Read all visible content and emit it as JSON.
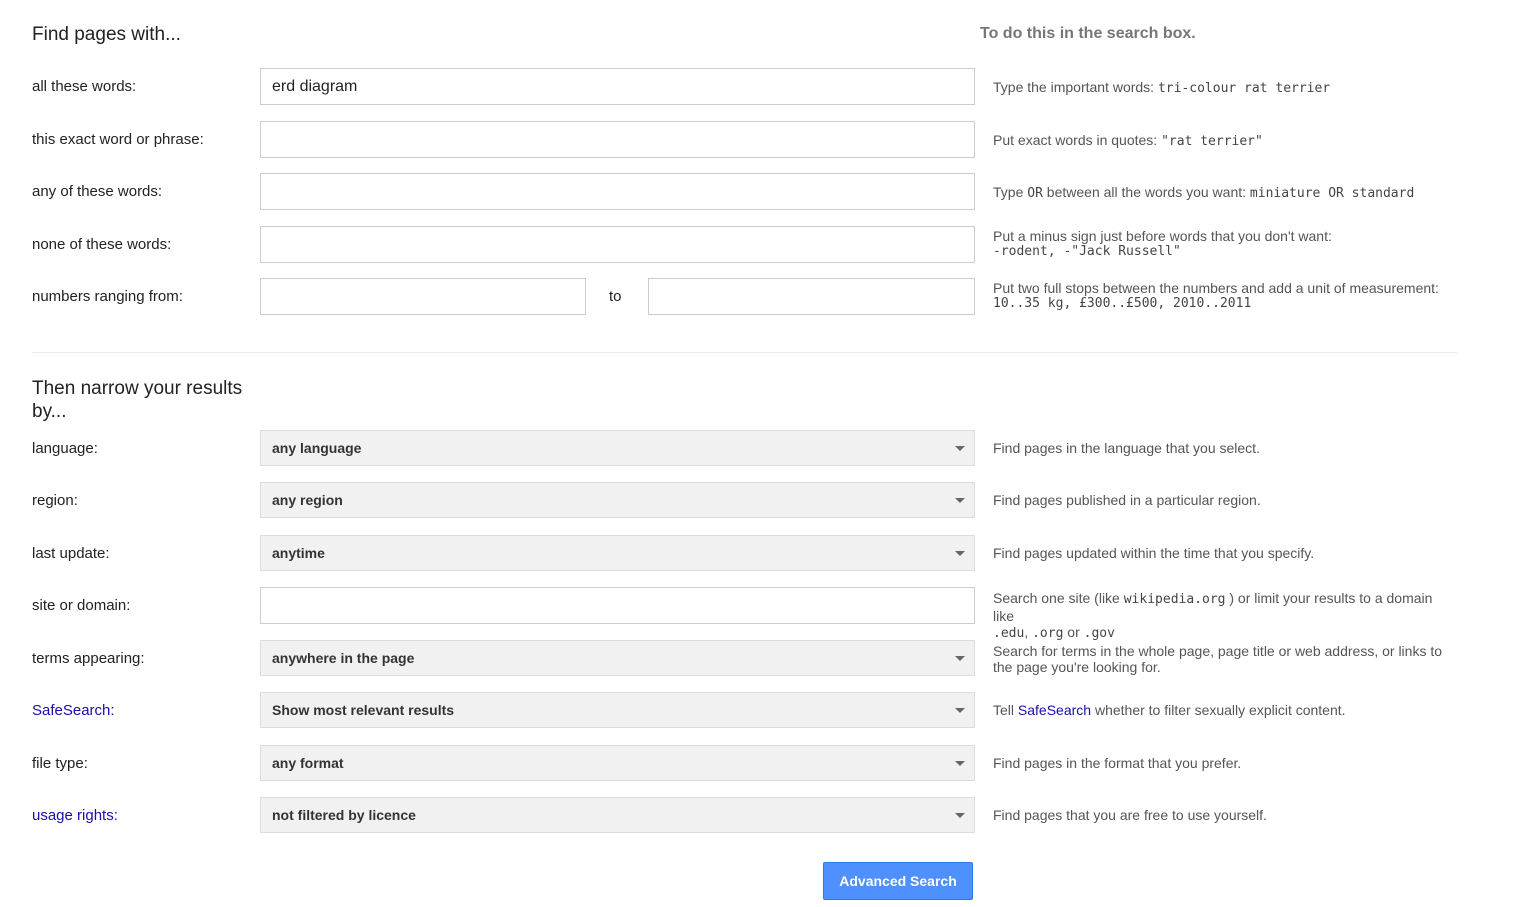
{
  "find_section": {
    "title": "Find pages with...",
    "hint_header": "To do this in the search box.",
    "rows": {
      "all_words": {
        "label": "all these words:",
        "value": "erd diagram",
        "hint_text": "Type the important words: ",
        "hint_code": "tri-colour rat terrier"
      },
      "exact_phrase": {
        "label": "this exact word or phrase:",
        "value": "",
        "hint_text": "Put exact words in quotes: ",
        "hint_code": "\"rat terrier\""
      },
      "any_words": {
        "label": "any of these words:",
        "value": "",
        "hint_text1": "Type ",
        "hint_code1": "OR",
        "hint_text2": " between all the words you want: ",
        "hint_code2": "miniature OR standard"
      },
      "none_words": {
        "label": "none of these words:",
        "value": "",
        "hint_text": "Put a minus sign just before words that you don't want:",
        "hint_code": "-rodent, -\"Jack Russell\""
      },
      "numbers": {
        "label": "numbers ranging from:",
        "from_value": "",
        "to_label": "to",
        "to_value": "",
        "hint_text": "Put two full stops between the numbers and add a unit of measurement:",
        "hint_code": "10..35 kg, £300..£500, 2010..2011"
      }
    }
  },
  "narrow_section": {
    "title": "Then narrow your results by...",
    "rows": {
      "language": {
        "label": "language:",
        "selected": "any language",
        "hint": "Find pages in the language that you select."
      },
      "region": {
        "label": "region:",
        "selected": "any region",
        "hint": "Find pages published in a particular region."
      },
      "last_update": {
        "label": "last update:",
        "selected": "anytime",
        "hint": "Find pages updated within the time that you specify."
      },
      "site": {
        "label": "site or domain:",
        "value": "",
        "hint_text1": "Search one site (like ",
        "hint_code1": "wikipedia.org",
        "hint_text2": " ) or limit your results to a domain like",
        "hint_code2": ".edu",
        "hint_text3": ", ",
        "hint_code3": ".org",
        "hint_text4": " or ",
        "hint_code4": ".gov"
      },
      "terms": {
        "label": "terms appearing:",
        "selected": "anywhere in the page",
        "hint": "Search for terms in the whole page, page title or web address, or links to the page you're looking for."
      },
      "safesearch": {
        "label": "SafeSearch",
        "label_suffix": ":",
        "selected": "Show most relevant results",
        "hint_text1": "Tell ",
        "hint_link": "SafeSearch",
        "hint_text2": " whether to filter sexually explicit content."
      },
      "file_type": {
        "label": "file type:",
        "selected": "any format",
        "hint": "Find pages in the format that you prefer."
      },
      "usage_rights": {
        "label": "usage rights",
        "label_suffix": ":",
        "selected": "not filtered by licence",
        "hint": "Find pages that you are free to use yourself."
      }
    }
  },
  "submit_button": {
    "label": "Advanced Search"
  },
  "colors": {
    "link": "#1a0dab",
    "button_bg": "#4d90fe",
    "select_bg": "#f1f1f1"
  },
  "icons": {
    "dropdown": "triangle-down"
  }
}
